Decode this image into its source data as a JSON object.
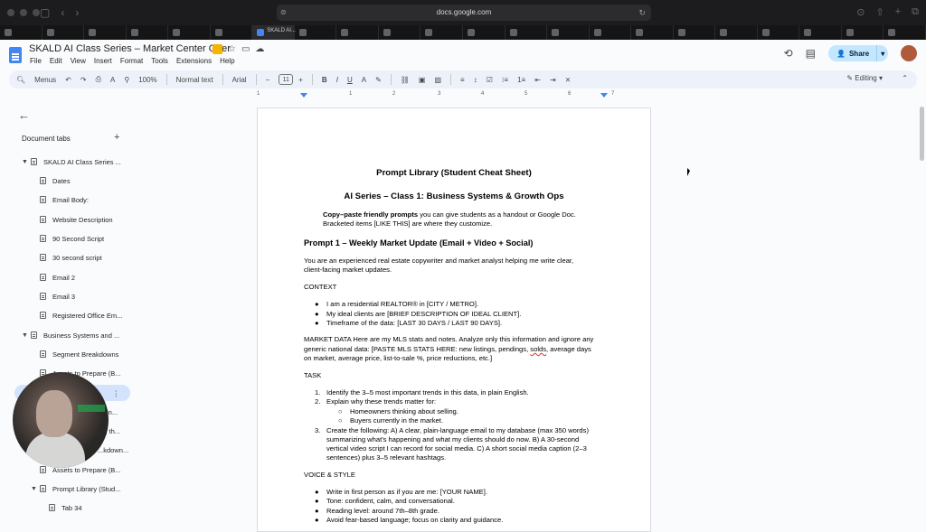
{
  "browser": {
    "address": "docs.google.com",
    "active_tab_label": "SKALD AI..."
  },
  "doc": {
    "title": "SKALD AI Class Series – Market Center Offer",
    "menu": [
      "File",
      "Edit",
      "View",
      "Insert",
      "Format",
      "Tools",
      "Extensions",
      "Help"
    ],
    "share_label": "Share"
  },
  "toolbar": {
    "menus": "Menus",
    "zoom": "100%",
    "style": "Normal text",
    "font": "Arial",
    "font_size": "11",
    "mode": "Editing"
  },
  "ruler": [
    "1",
    "1",
    "2",
    "3",
    "4",
    "5",
    "6",
    "7"
  ],
  "sidebar": {
    "header": "Document tabs",
    "items": [
      {
        "label": "SKALD AI Class Series ...",
        "level": 0,
        "expanded": true
      },
      {
        "label": "Dates",
        "level": 1
      },
      {
        "label": "Email Body:",
        "level": 1
      },
      {
        "label": "Website Description",
        "level": 1
      },
      {
        "label": "90 Second Script",
        "level": 1
      },
      {
        "label": "30 second script",
        "level": 1
      },
      {
        "label": "Email 2",
        "level": 1
      },
      {
        "label": "Email 3",
        "level": 1
      },
      {
        "label": "Registered Office Em...",
        "level": 1
      },
      {
        "label": "Business Systems and ...",
        "level": 0,
        "expanded": true
      },
      {
        "label": "Segment Breakdowns",
        "level": 1
      },
      {
        "label": "Assets to Prepare (B...",
        "level": 1
      },
      {
        "label": "",
        "level": 1,
        "selected": true
      },
      {
        "label": "...sin...",
        "level": 1
      },
      {
        "label": "...g th...",
        "level": 1
      },
      {
        "label": "...kdown...",
        "level": 1
      },
      {
        "label": "Assets to Prepare (B...",
        "level": 1
      },
      {
        "label": "Prompt Library (Stud...",
        "level": 1,
        "expanded": true
      },
      {
        "label": "Tab 34",
        "level": 2
      }
    ]
  },
  "page": {
    "title": "Prompt Library (Student Cheat Sheet)",
    "subtitle": "AI Series – Class 1: Business Systems & Growth Ops",
    "intro_bold": "Copy–paste friendly prompts",
    "intro_rest": " you can give students as a handout or Google Doc.",
    "intro_line2": "Bracketed items [LIKE THIS] are where they customize.",
    "prompt1_heading": "Prompt 1 – Weekly Market Update (Email + Video + Social)",
    "p1_line1": "You are an experienced real estate copywriter and market analyst helping me write clear,",
    "p1_line2": "client-facing market updates.",
    "context_label": "CONTEXT",
    "context_bullets": [
      "I am a residential REALTOR® in [CITY / METRO].",
      "My ideal clients are [BRIEF DESCRIPTION OF IDEAL CLIENT].",
      "Timeframe of the data: [LAST 30 DAYS / LAST 90 DAYS]."
    ],
    "market_line1": "MARKET DATA Here are my MLS stats and notes. Analyze only this information and ignore any",
    "market_line2a": "generic national data: [PASTE MLS STATS HERE: new listings, pendings, ",
    "market_line2b": "solds",
    "market_line2c": ", average days",
    "market_line3": "on market, average price, list-to-sale %, price reductions, etc.]",
    "task_label": "TASK",
    "task_1": "Identify the 3–5 most important trends in this data, in plain English.",
    "task_2": "Explain why these trends matter for:",
    "task_2_sub": [
      "Homeowners thinking about selling.",
      "Buyers currently in the market."
    ],
    "task_3_line1": "Create the following: A) A clear, plain-language email to my database (max 350 words)",
    "task_3_line2": "summarizing what's happening and what my clients should do now. B) A 30-second",
    "task_3_line3": "vertical video script I can record for social media. C) A short social media caption (2–3",
    "task_3_line4": "sentences) plus 3–5 relevant hashtags.",
    "voice_label": "VOICE & STYLE",
    "voice_bullets": [
      "Write in first person as if you are me: [YOUR NAME].",
      "Tone: confident, calm, and conversational.",
      "Reading level: around 7th–8th grade.",
      "Avoid fear-based language; focus on clarity and guidance."
    ]
  }
}
